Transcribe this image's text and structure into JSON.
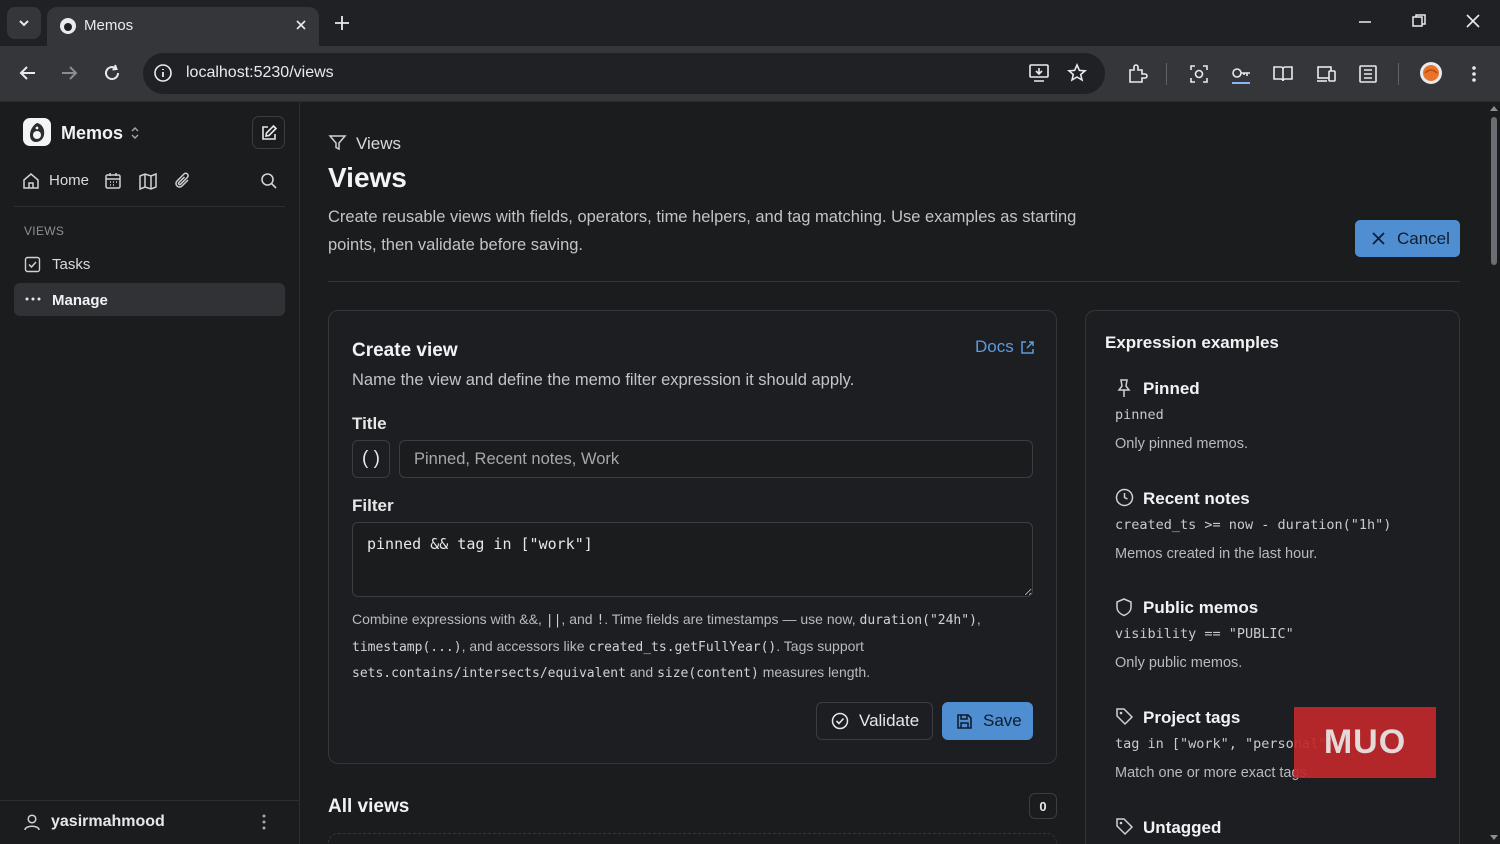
{
  "browser": {
    "tab_title": "Memos",
    "url": "localhost:5230/views"
  },
  "sidebar": {
    "brand": "Memos",
    "nav": {
      "home_label": "Home"
    },
    "section_heading": "VIEWS",
    "items": [
      {
        "label": "Tasks",
        "icon": "checkbox-icon"
      },
      {
        "label": "Manage",
        "icon": "more-dots-icon",
        "active": true
      }
    ],
    "user": {
      "name": "yasirmahmood"
    }
  },
  "header": {
    "breadcrumb": "Views",
    "title": "Views",
    "description": "Create reusable views with fields, operators, time helpers, and tag matching. Use examples as starting points, then validate before saving.",
    "cancel_label": "Cancel"
  },
  "create_view": {
    "heading": "Create view",
    "docs_label": "Docs",
    "description": "Name the view and define the memo filter expression it should apply.",
    "title_label": "Title",
    "icon_picker": "( )",
    "title_placeholder": "Pinned, Recent notes, Work",
    "filter_label": "Filter",
    "filter_value": "pinned && tag in [\"work\"]",
    "help": {
      "t1": "Combine expressions with ",
      "and_op": "&&",
      "t2": ", ",
      "or_op": "||",
      "t3": ", and ",
      "not_op": "!",
      "t4": ". Time fields are timestamps — use ",
      "now": "now",
      "t5": ", ",
      "duration": "duration(\"24h\")",
      "t6": ",",
      "timestamp": "timestamp(...)",
      "t7": ", and accessors like ",
      "accessor": "created_ts.getFullYear()",
      "t8": ". Tags support",
      "sets": "sets.contains/intersects/equivalent",
      "t9": " and ",
      "size": "size(content)",
      "t10": " measures length."
    },
    "validate_label": "Validate",
    "save_label": "Save"
  },
  "all_views": {
    "heading": "All views",
    "count": "0"
  },
  "examples": {
    "heading": "Expression examples",
    "items": [
      {
        "name": "Pinned",
        "icon": "pin-icon",
        "code": "pinned",
        "desc": "Only pinned memos."
      },
      {
        "name": "Recent notes",
        "icon": "clock-icon",
        "code": "created_ts >= now - duration(\"1h\")",
        "desc": "Memos created in the last hour."
      },
      {
        "name": "Public memos",
        "icon": "shield-icon",
        "code": "visibility == \"PUBLIC\"",
        "desc": "Only public memos."
      },
      {
        "name": "Project tags",
        "icon": "tag-icon",
        "code": "tag in [\"work\", \"personal\"]",
        "desc": "Match one or more exact tags."
      },
      {
        "name": "Untagged",
        "icon": "tag-icon",
        "code": "",
        "desc": ""
      }
    ]
  },
  "watermark": "MUO",
  "colors": {
    "accent": "#4f8fd1",
    "background": "#1b1c1e",
    "watermark": "#c0282c"
  }
}
